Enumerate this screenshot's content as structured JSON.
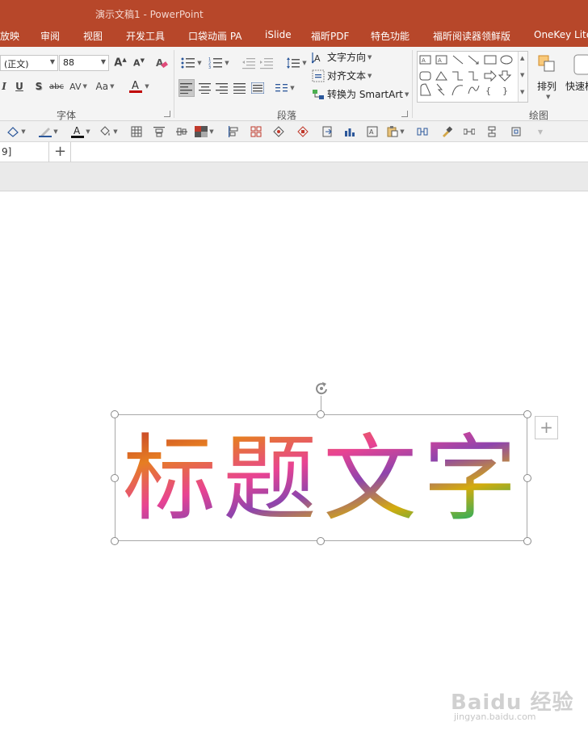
{
  "window": {
    "title": "演示文稿1 - PowerPoint"
  },
  "tabs": [
    {
      "label": "放映"
    },
    {
      "label": "审阅"
    },
    {
      "label": "视图"
    },
    {
      "label": "开发工具"
    },
    {
      "label": "口袋动画 PA"
    },
    {
      "label": "iSlide"
    },
    {
      "label": "福昕PDF"
    },
    {
      "label": "特色功能"
    },
    {
      "label": "福昕阅读器领鲜版"
    },
    {
      "label": "OneKey Lite"
    }
  ],
  "ribbon": {
    "font": {
      "group_label": "字体",
      "font_name": "(正文)",
      "font_size": "88",
      "case_label": "Aa"
    },
    "paragraph": {
      "group_label": "段落",
      "text_direction": "文字方向",
      "align_text": "对齐文本",
      "convert_smartart": "转换为 SmartArt"
    },
    "drawing": {
      "group_label": "绘图",
      "arrange": "排列",
      "quick_styles": "快速样"
    }
  },
  "doc_tab": {
    "label": "9]"
  },
  "slide": {
    "title_text": "标题文字",
    "fill_colors": [
      "#c0392b",
      "#e67e22",
      "#d4ac0d",
      "#27ae60",
      "#8e44ad",
      "#e84393"
    ]
  },
  "watermark": {
    "brand": "Baidu 经验",
    "url": "jingyan.baidu.com"
  },
  "colors": {
    "accent": "#b7472a",
    "ribbon_bg": "#f4f4f4"
  }
}
